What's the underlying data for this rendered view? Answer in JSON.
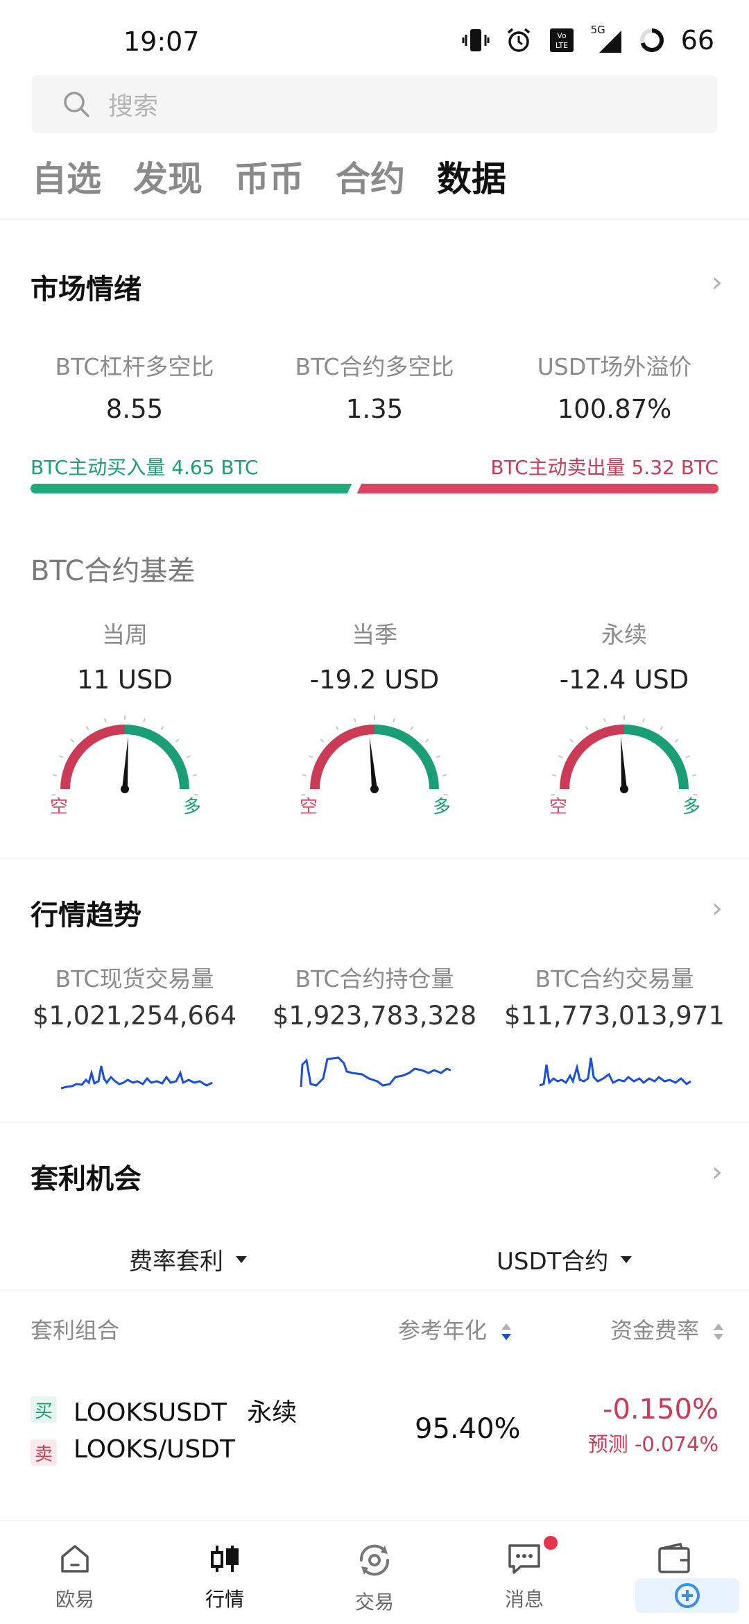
{
  "status_bar": {
    "time": "19:07",
    "network": "5G",
    "battery": "66"
  },
  "search": {
    "placeholder": "搜索"
  },
  "tabs": [
    {
      "label": "自选",
      "active": false
    },
    {
      "label": "发现",
      "active": false
    },
    {
      "label": "币币",
      "active": false
    },
    {
      "label": "合约",
      "active": false
    },
    {
      "label": "数据",
      "active": true
    }
  ],
  "market_sentiment": {
    "title": "市场情绪",
    "metrics": [
      {
        "label": "BTC杠杆多空比",
        "value": "8.55"
      },
      {
        "label": "BTC合约多空比",
        "value": "1.35"
      },
      {
        "label": "USDT场外溢价",
        "value": "100.87%"
      }
    ],
    "buy_flow": "BTC主动买入量 4.65 BTC",
    "sell_flow": "BTC主动卖出量 5.32 BTC",
    "buy_fraction": 0.466
  },
  "basis": {
    "title": "BTC合约基差",
    "short_label": "空",
    "long_label": "多",
    "gauges": [
      {
        "label": "当周",
        "value": "11 USD",
        "needle": 0.52
      },
      {
        "label": "当季",
        "value": "-19.2 USD",
        "needle": 0.47
      },
      {
        "label": "永续",
        "value": "-12.4 USD",
        "needle": 0.48
      }
    ]
  },
  "trend": {
    "title": "行情趋势",
    "items": [
      {
        "label": "BTC现货交易量",
        "value": "$1,021,254,664"
      },
      {
        "label": "BTC合约持仓量",
        "value": "$1,923,783,328"
      },
      {
        "label": "BTC合约交易量",
        "value": "$11,773,013,971"
      }
    ],
    "line_color": "#1a4fd6"
  },
  "arbitrage": {
    "title": "套利机会",
    "filter_type": "费率套利",
    "filter_market": "USDT合约",
    "columns": {
      "combo": "套利组合",
      "annual": "参考年化",
      "funding": "资金费率"
    },
    "rows": [
      {
        "buy_badge": "买",
        "buy_pair": "LOOKSUSDT",
        "buy_suffix": "永续",
        "sell_badge": "卖",
        "sell_pair": "LOOKS/USDT",
        "annual": "95.40%",
        "funding": "-0.150%",
        "forecast": "预测 -0.074%"
      }
    ]
  },
  "bottom_nav": [
    {
      "label": "欧易",
      "icon": "home-icon",
      "active": false
    },
    {
      "label": "行情",
      "icon": "candlestick-icon",
      "active": true
    },
    {
      "label": "交易",
      "icon": "trade-icon",
      "active": false
    },
    {
      "label": "消息",
      "icon": "message-icon",
      "active": false,
      "dot": true
    },
    {
      "label": "",
      "icon": "wallet-icon",
      "active": false
    }
  ],
  "colors": {
    "green": "#1a9e76",
    "red": "#cc3b56",
    "blue": "#1a4fd6"
  }
}
